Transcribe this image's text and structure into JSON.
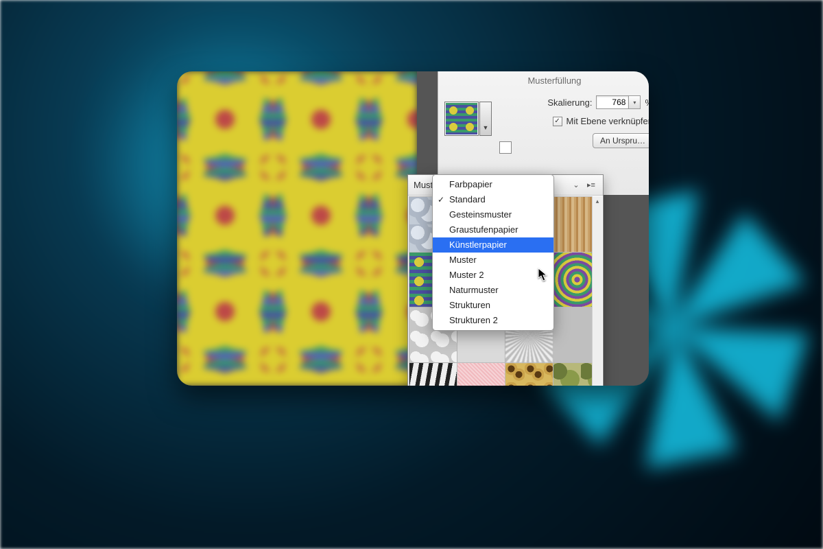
{
  "dialog": {
    "title": "Musterfüllung",
    "scale_label": "Skalierung:",
    "scale_value": "768",
    "scale_unit": "%",
    "link_label": "Mit Ebene verknüpfen",
    "link_checked": true,
    "snap_button": "An Urspru…"
  },
  "picker": {
    "title_truncated": "Muster"
  },
  "menu": {
    "items": [
      {
        "label": "Farbpapier",
        "checked": false,
        "selected": false
      },
      {
        "label": "Standard",
        "checked": true,
        "selected": false
      },
      {
        "label": "Gesteinsmuster",
        "checked": false,
        "selected": false
      },
      {
        "label": "Graustufenpapier",
        "checked": false,
        "selected": false
      },
      {
        "label": "Künstlerpapier",
        "checked": false,
        "selected": true
      },
      {
        "label": "Muster",
        "checked": false,
        "selected": false
      },
      {
        "label": "Muster 2",
        "checked": false,
        "selected": false
      },
      {
        "label": "Naturmuster",
        "checked": false,
        "selected": false
      },
      {
        "label": "Strukturen",
        "checked": false,
        "selected": false
      },
      {
        "label": "Strukturen 2",
        "checked": false,
        "selected": false
      }
    ]
  }
}
